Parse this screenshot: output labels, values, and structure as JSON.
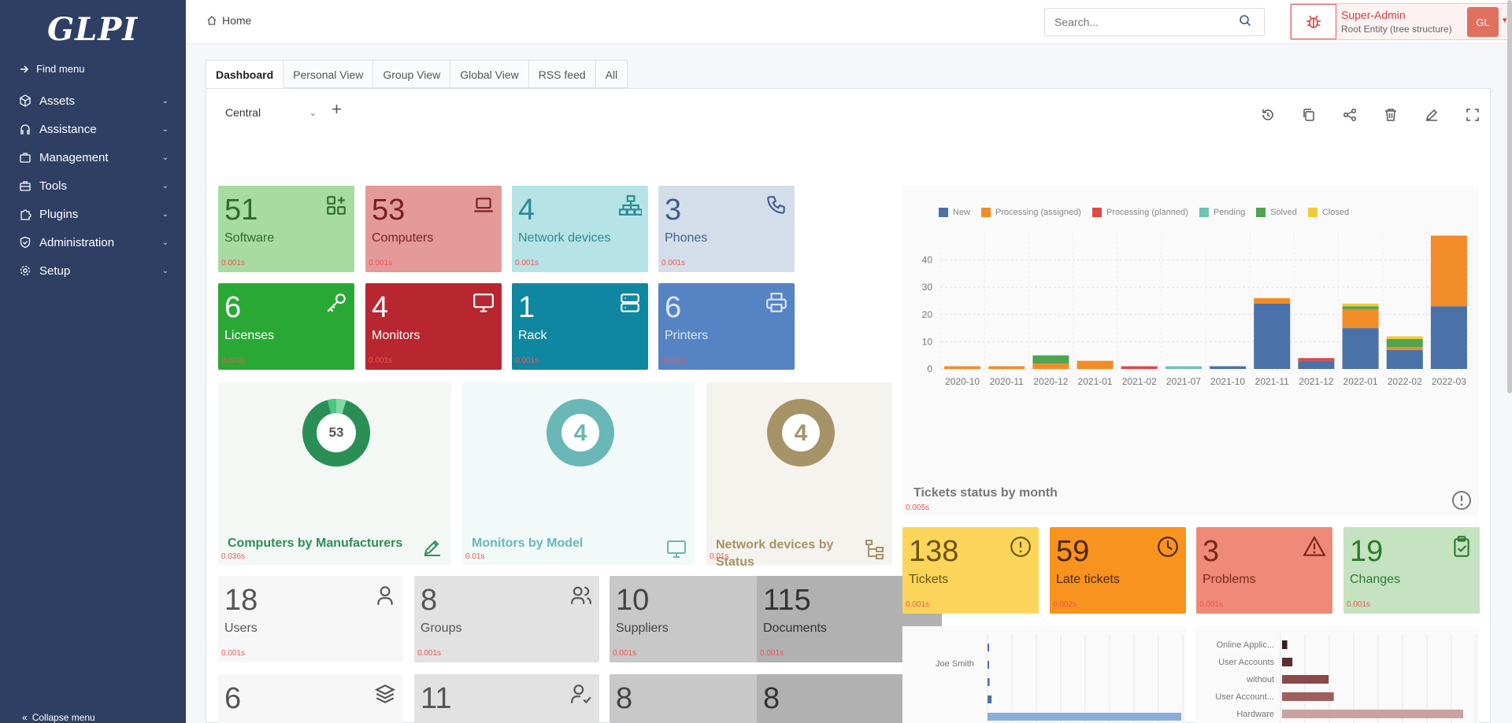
{
  "sidebar": {
    "logo": "GLPI",
    "find_menu": "Find menu",
    "items": [
      {
        "label": "Assets",
        "icon": "cube-icon"
      },
      {
        "label": "Assistance",
        "icon": "headset-icon"
      },
      {
        "label": "Management",
        "icon": "briefcase-icon"
      },
      {
        "label": "Tools",
        "icon": "briefcase-icon"
      },
      {
        "label": "Plugins",
        "icon": "puzzle-icon"
      },
      {
        "label": "Administration",
        "icon": "shield-icon"
      },
      {
        "label": "Setup",
        "icon": "gear-icon"
      }
    ],
    "collapse": "Collapse menu"
  },
  "header": {
    "breadcrumb": "Home",
    "search_placeholder": "Search...",
    "profile_name": "Super-Admin",
    "profile_entity": "Root Entity (tree structure)",
    "avatar_initials": "GL"
  },
  "tabs": [
    "Dashboard",
    "Personal View",
    "Group View",
    "Global View",
    "RSS feed",
    "All"
  ],
  "dashboard_select": "Central",
  "cards_row1": [
    {
      "num": "51",
      "label": "Software",
      "time": "0.001s",
      "bg": "#a8dba2",
      "fg": "#2d6b2a",
      "icon": "apps-plus-icon"
    },
    {
      "num": "53",
      "label": "Computers",
      "time": "0.001s",
      "bg": "#e59a9a",
      "fg": "#7a2020",
      "icon": "laptop-icon"
    },
    {
      "num": "4",
      "label": "Network devices",
      "time": "0.001s",
      "bg": "#b6e3e6",
      "fg": "#2b8a93",
      "icon": "network-icon"
    },
    {
      "num": "3",
      "label": "Phones",
      "time": "0.001s",
      "bg": "#d4deeb",
      "fg": "#3f5f8a",
      "icon": "phone-icon"
    }
  ],
  "cards_row2": [
    {
      "num": "6",
      "label": "Licenses",
      "time": "0.001s",
      "bg": "#2aa836",
      "fg": "#ffffff",
      "icon": "key-icon"
    },
    {
      "num": "4",
      "label": "Monitors",
      "time": "0.001s",
      "bg": "#b8262f",
      "fg": "#ffffff",
      "icon": "monitor-icon"
    },
    {
      "num": "1",
      "label": "Rack",
      "time": "0.001s",
      "bg": "#0f87a1",
      "fg": "#ffffff",
      "icon": "server-icon"
    },
    {
      "num": "6",
      "label": "Printers",
      "time": "0.001s",
      "bg": "#5683c4",
      "fg": "#dfe8f6",
      "icon": "printer-icon"
    }
  ],
  "widgets": [
    {
      "title": "Computers by Manufacturers",
      "value": "53",
      "time": "0.036s",
      "color": "#2a8f55",
      "icon": "edit-icon"
    },
    {
      "title": "Monitors by Model",
      "value": "4",
      "time": "0.01s",
      "color": "#6ab7b7",
      "icon": "monitor-icon"
    },
    {
      "title": "Network devices by Status",
      "value": "4",
      "time": "0.01s",
      "color": "#a69367",
      "icon": "hierarchy-icon"
    }
  ],
  "cards_row3": [
    {
      "num": "18",
      "label": "Users",
      "time": "0.001s",
      "bg": "#f7f7f7",
      "fg": "#555",
      "icon": "user-icon"
    },
    {
      "num": "8",
      "label": "Groups",
      "time": "0.001s",
      "bg": "#e2e2e2",
      "fg": "#555",
      "icon": "users-icon"
    },
    {
      "num": "10",
      "label": "Suppliers",
      "time": "0.001s",
      "bg": "#c8c8c8",
      "fg": "#444",
      "icon": "dolly-icon"
    },
    {
      "num": "115",
      "label": "Documents",
      "time": "0.001s",
      "bg": "#b1b1b1",
      "fg": "#333",
      "icon": "files-icon"
    }
  ],
  "cards_row4": [
    {
      "num": "6",
      "bg": "#f7f7f7",
      "fg": "#555",
      "icon": "layers-icon"
    },
    {
      "num": "11",
      "bg": "#e2e2e2",
      "fg": "#555",
      "icon": "user-check-icon"
    },
    {
      "num": "8",
      "bg": "#c8c8c8",
      "fg": "#444",
      "icon": "lifebuoy-icon"
    },
    {
      "num": "8",
      "bg": "#b1b1b1",
      "fg": "#333",
      "icon": "layout-icon"
    }
  ],
  "tickets_cards": [
    {
      "num": "138",
      "label": "Tickets",
      "time": "0.001s",
      "bg": "#fcd55a",
      "fg": "#6b5410",
      "icon": "alert-circle-icon"
    },
    {
      "num": "59",
      "label": "Late tickets",
      "time": "0.002s",
      "bg": "#f7931e",
      "fg": "#4a2800",
      "icon": "clock-icon"
    },
    {
      "num": "3",
      "label": "Problems",
      "time": "0.001s",
      "bg": "#ef8a78",
      "fg": "#7a2818",
      "icon": "warning-icon"
    },
    {
      "num": "19",
      "label": "Changes",
      "time": "0.001s",
      "bg": "#c5e3c0",
      "fg": "#2f7a2f",
      "icon": "clipboard-check-icon"
    }
  ],
  "chart_data": {
    "type": "bar",
    "stacked": true,
    "title": "Tickets status by month",
    "time": "0.005s",
    "categories": [
      "2020-10",
      "2020-11",
      "2020-12",
      "2021-01",
      "2021-02",
      "2021-07",
      "2021-10",
      "2021-11",
      "2021-12",
      "2022-01",
      "2022-02",
      "2022-03"
    ],
    "series": [
      {
        "name": "New",
        "color": "#4a72a8",
        "values": [
          0,
          0,
          0,
          0,
          0,
          0,
          1,
          24,
          3,
          15,
          7,
          23
        ]
      },
      {
        "name": "Processing (assigned)",
        "color": "#f28c28",
        "values": [
          1,
          1,
          2,
          3,
          0,
          0,
          0,
          2,
          0,
          7,
          1,
          26
        ]
      },
      {
        "name": "Processing (planned)",
        "color": "#e04848",
        "values": [
          0,
          0,
          0,
          0,
          1,
          0,
          0,
          0,
          1,
          0,
          0,
          0
        ]
      },
      {
        "name": "Pending",
        "color": "#6fc3b4",
        "values": [
          0,
          0,
          0,
          0,
          0,
          1,
          0,
          0,
          0,
          0,
          0,
          0
        ]
      },
      {
        "name": "Solved",
        "color": "#4fa54f",
        "values": [
          0,
          0,
          3,
          0,
          0,
          0,
          0,
          0,
          0,
          1,
          3,
          0
        ]
      },
      {
        "name": "Closed",
        "color": "#f2c937",
        "values": [
          0,
          0,
          0,
          0,
          0,
          0,
          0,
          0,
          0,
          1,
          1,
          0
        ]
      }
    ],
    "yticks": [
      0,
      10,
      20,
      30,
      40
    ],
    "ylim": [
      0,
      50
    ],
    "grid": true,
    "legend": "top-left"
  },
  "bottom_chart_left": {
    "label": "Joe Smith",
    "values": [
      0.2,
      0.2,
      0.4,
      0.8,
      38
    ],
    "color": "#4a72a8"
  },
  "bottom_chart_right": {
    "labels": [
      "Online Applic...",
      "User Accounts",
      "without",
      "User Account...",
      "Hardware"
    ],
    "values": [
      1,
      2,
      9,
      10,
      35
    ],
    "colors": [
      "#3a1f1f",
      "#5a2e2e",
      "#8a4a4a",
      "#9e5f5f",
      "#c9a2a2"
    ]
  }
}
